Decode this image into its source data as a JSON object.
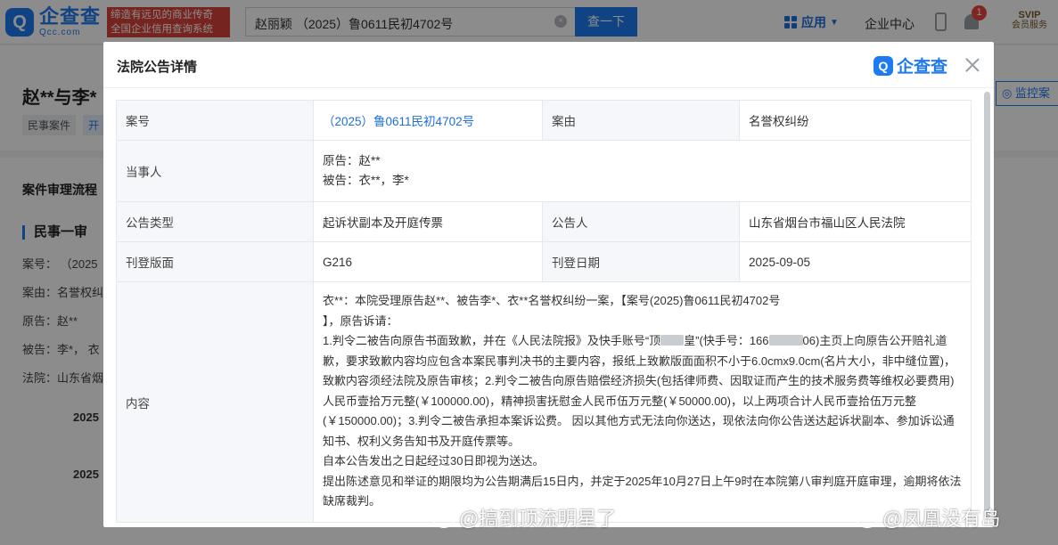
{
  "topbar": {
    "logo_cn": "企查查",
    "logo_en": "Qcc.com",
    "logo_mark": "Q",
    "slogan_line1": "缔造有远见的商业传奇",
    "slogan_line2": "全国企业信用查询系统",
    "search_value": "赵丽颖 （2025）鲁0611民初4702号",
    "search_button": "查一下",
    "app_label": "应用",
    "center_label": "企业中心",
    "notification_count": "1",
    "svip_label": "SVIP",
    "svip_sub": "会员服务"
  },
  "background": {
    "title": "赵**与李*",
    "tags": [
      "民事案件",
      "开"
    ],
    "monitor_label": "监控案",
    "section_title": "案件审理流程",
    "sub_title": "民事一审",
    "lines": [
      "案号： （2025",
      "案由：名誉权纠",
      "原告：赵**",
      "被告：李*， 衣",
      "法院：山东省烟"
    ],
    "years": [
      "2025",
      "2025"
    ]
  },
  "modal": {
    "title": "法院公告详情",
    "logo_text": "企查查",
    "logo_mark": "Q",
    "rows": {
      "case_no_label": "案号",
      "case_no_value": "（2025）鲁0611民初4702号",
      "cause_label": "案由",
      "cause_value": "名誉权纠纷",
      "parties_label": "当事人",
      "plaintiff": "原告：赵**",
      "defendant": "被告：衣**，李*",
      "type_label": "公告类型",
      "type_value": "起诉状副本及开庭传票",
      "announcer_label": "公告人",
      "announcer_value": "山东省烟台市福山区人民法院",
      "page_label": "刊登版面",
      "page_value": "G216",
      "date_label": "刊登日期",
      "date_value": "2025-09-05",
      "content_label": "内容"
    },
    "content": {
      "p1": "衣**：本院受理原告赵**、被告李*、衣**名誉权纠纷一案，【案号(2025)鲁0611民初4702号",
      "p2": "】，原告诉请：",
      "p3a": "1.判令二被告向原告书面致歉，并在《人民法院报》及快手账号“顶",
      "p3b": "皇”(快手号：166",
      "p3c": "06)主页上向原告公开赔礼道歉，要求致歉内容均应包含本案民事判决书的主要内容，报纸上致歉版面面积不小于6.0cmx9.0cm(名片大小，非中缝位置)，致歉内容须经法院及原告审核；2.判令二被告向原告赔偿经济损失(包括律师费、因取证而产生的技术服务费等维权必要费用)人民币壹拾万元整(￥100000.00)，精神损害抚慰金人民币伍万元整(￥50000.00)，以上两项合计人民币壹拾伍万元整(￥150000.00)；3.判令二被告承担本案诉讼费。 因以其他方式无法向你送达，现依法向你公告送达起诉状副本、参加诉讼通知书、权利义务告知书及开庭传票等。",
      "p4": "自本公告发出之日起经过30日即视为送达。",
      "p5": "提出陈述意见和举证的期限均为公告期满后15日内，并定于2025年10月27日上午9时在本院第八审判庭开庭审理，逾期将依法缺席裁判。"
    }
  },
  "watermark": {
    "left": "@搞到顶流明星了",
    "right": "@凤凰没有岛"
  }
}
